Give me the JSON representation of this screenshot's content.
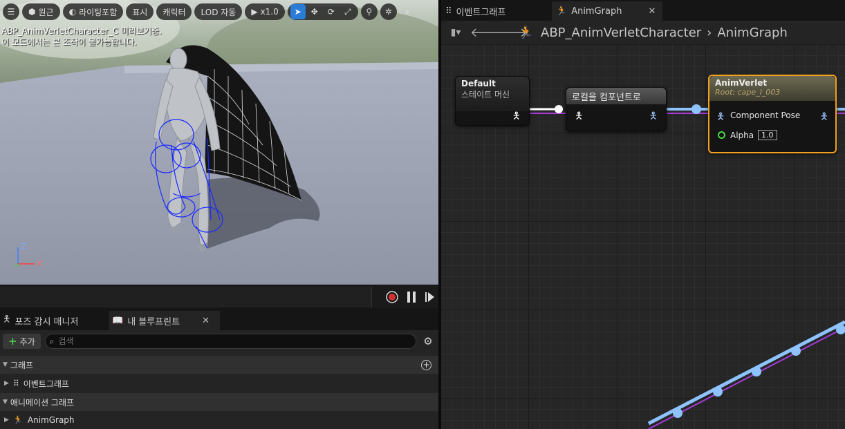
{
  "viewport": {
    "toolbar": {
      "perspective_label": "원근",
      "lighting_label": "라이팅포함",
      "show_label": "표시",
      "character_label": "캐릭터",
      "lod_label": "LOD 자동",
      "speed_label": "x1.0"
    },
    "message_line1": "ABP_AnimVerletCharacter_C 미리보기중.",
    "message_line2": "이 모드에서는 본 조작이 불가능합니다.",
    "axis_z": "Z",
    "axis_x": "X"
  },
  "lower_tabs": {
    "pose_watch_label": "포즈 감시 매니저",
    "my_blueprint_label": "내 블루프린트"
  },
  "my_blueprint": {
    "add_label": "추가",
    "search_placeholder": "검색",
    "graphs_section": "그래프",
    "event_graph_item": "이벤트그래프",
    "anim_graphs_section": "애니메이션 그래프",
    "anim_graph_item": "AnimGraph"
  },
  "graph_tabs": {
    "event_graph_tab": "이벤트그래프",
    "anim_graph_tab": "AnimGraph"
  },
  "breadcrumb": {
    "blueprint": "ABP_AnimVerletCharacter",
    "graph": "AnimGraph"
  },
  "nodes": {
    "state_machine": {
      "title": "Default",
      "subtitle": "스테이트 머신"
    },
    "local_to_component": {
      "title": "로컬을 컴포넌트로"
    },
    "anim_verlet": {
      "title": "AnimVerlet",
      "subtitle": "Root: cape_l_003",
      "pose_pin": "Component Pose",
      "alpha_pin": "Alpha",
      "alpha_value": "1.0"
    }
  },
  "colors": {
    "accent": "#2b7cd6",
    "pose_wire": "#8ec3ff",
    "selected_border": "#f0a21e",
    "purple_wire": "#a63bd8"
  }
}
